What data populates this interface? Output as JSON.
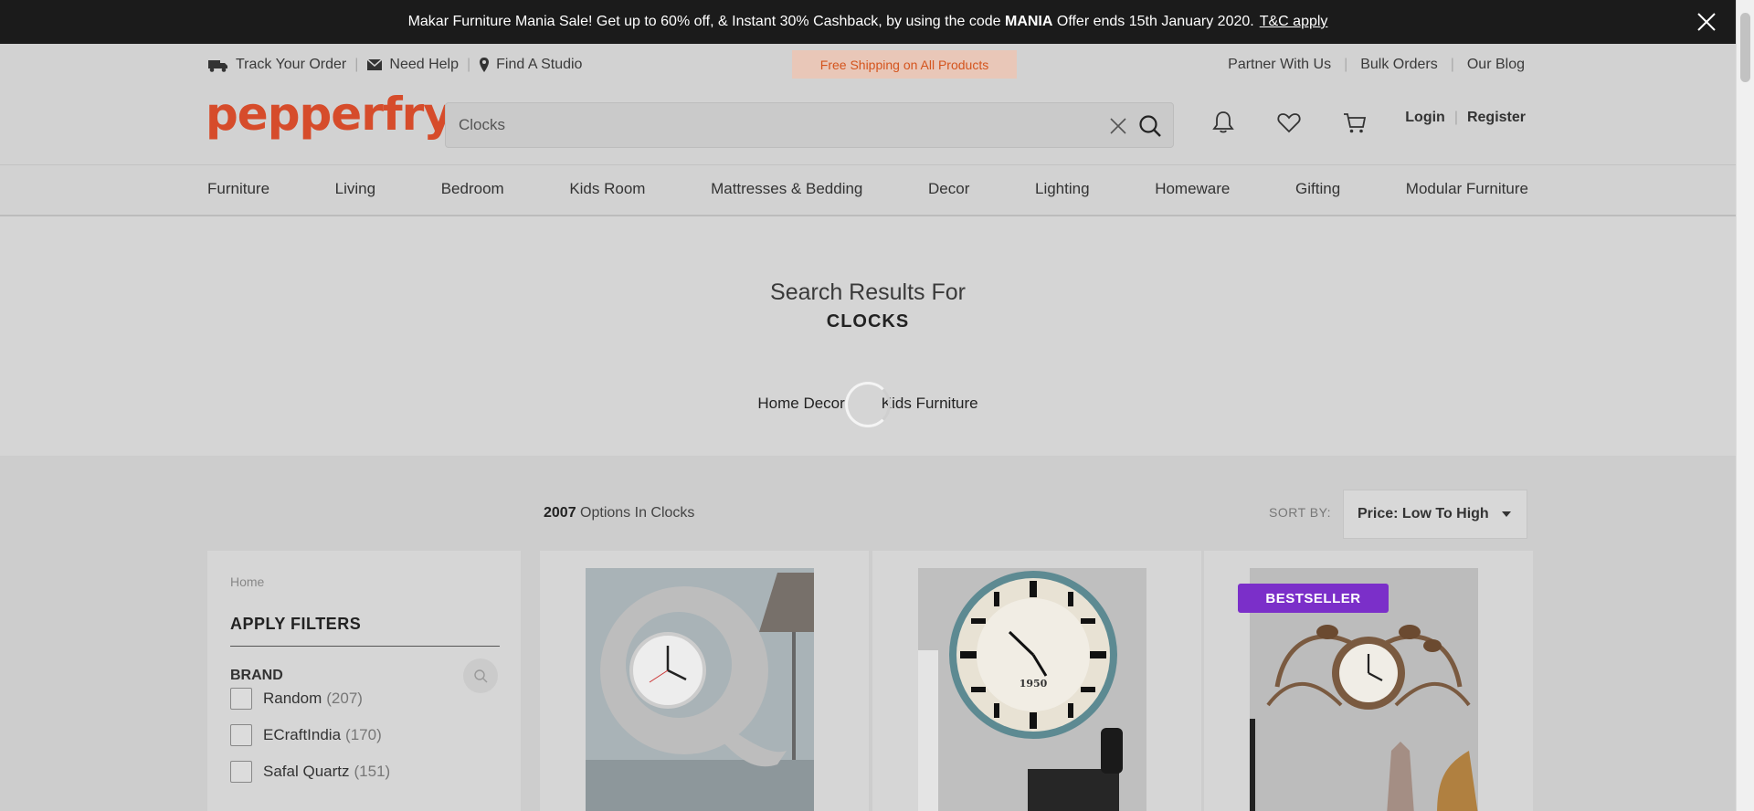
{
  "promo": {
    "text_before": "Makar Furniture Mania Sale! Get up to 60% off, & Instant 30% Cashback, by using the code ",
    "code": "MANIA",
    "text_after": " Offer ends 15th January 2020.",
    "link": "T&C apply"
  },
  "utility": {
    "track_order": "Track Your Order",
    "need_help": "Need Help",
    "find_studio": "Find A Studio",
    "free_shipping": "Free Shipping on All Products",
    "partner": "Partner With Us",
    "bulk_orders": "Bulk Orders",
    "blog": "Our Blog"
  },
  "header": {
    "logo_text": "pepperfry",
    "search_value": "Clocks",
    "login": "Login",
    "register": "Register"
  },
  "categories": [
    "Furniture",
    "Living",
    "Bedroom",
    "Kids Room",
    "Mattresses & Bedding",
    "Decor",
    "Lighting",
    "Homeware",
    "Gifting",
    "Modular Furniture"
  ],
  "results": {
    "heading": "Search Results For",
    "term": "CLOCKS",
    "chips": [
      "Home Decor",
      "Kids Furniture"
    ]
  },
  "listing": {
    "count": "2007",
    "count_label": " Options In Clocks",
    "sort_label": "SORT BY:",
    "sort_value": "Price: Low To High"
  },
  "filters": {
    "breadcrumb": "Home",
    "title": "APPLY FILTERS",
    "section": "BRAND",
    "options": [
      {
        "label": "Random",
        "count": "(207)"
      },
      {
        "label": "ECraftIndia",
        "count": "(170)"
      },
      {
        "label": "Safal Quartz",
        "count": "(151)"
      }
    ]
  },
  "products": [
    {
      "name": "grey-wall-clock"
    },
    {
      "name": "vintage-roman-clock",
      "clock_text": "1950"
    },
    {
      "name": "bird-metal-clock",
      "badge": "BESTSELLER"
    }
  ],
  "colors": {
    "accent": "#d64c2b",
    "badge": "#7b2fc9",
    "shipping": "#d4541d"
  }
}
